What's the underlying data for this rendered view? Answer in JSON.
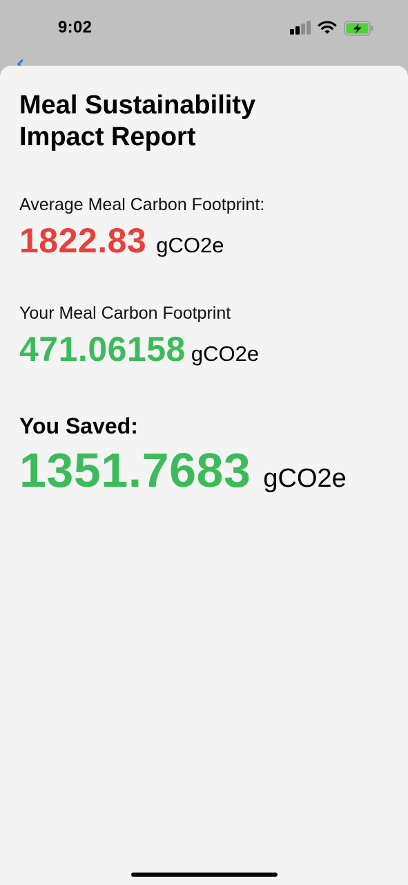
{
  "status_bar": {
    "time": "9:02",
    "signal_bars": 4,
    "signal_bars_active": 2,
    "battery_state": "charging",
    "battery_color": "#4cd137"
  },
  "report": {
    "title_line1": "Meal Sustainability",
    "title_line2": "Impact Report",
    "average": {
      "label": "Average Meal Carbon Footprint:",
      "value": "1822.83",
      "unit": "gCO2e",
      "color": "#e8403a"
    },
    "yours": {
      "label": "Your Meal Carbon Footprint",
      "value": "471.06158",
      "unit": "gCO2e",
      "color": "#3dbb5b"
    },
    "saved": {
      "label": "You Saved:",
      "value": "1351.7683",
      "unit": "gCO2e",
      "color": "#3dbb5b"
    }
  }
}
